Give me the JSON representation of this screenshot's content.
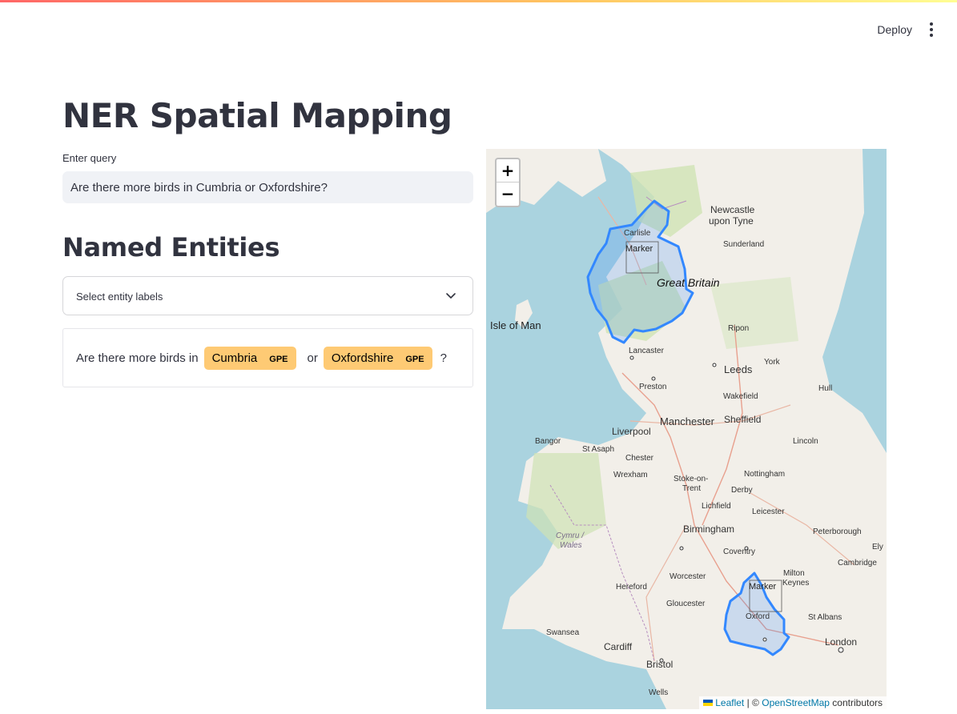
{
  "header": {
    "deploy_label": "Deploy",
    "menu_icon": "more-vertical-icon"
  },
  "page": {
    "title": "NER Spatial Mapping"
  },
  "query": {
    "label": "Enter query",
    "value": "Are there more birds in Cumbria or Oxfordshire?"
  },
  "entities": {
    "title": "Named Entities",
    "select_placeholder": "Select entity labels",
    "sentence": {
      "part1": "Are there more birds in",
      "entity1": {
        "text": "Cumbria",
        "label": "GPE"
      },
      "part2": "or",
      "entity2": {
        "text": "Oxfordshire",
        "label": "GPE"
      },
      "part3": "?"
    },
    "highlight_color": "#feca74"
  },
  "map": {
    "zoom_in_label": "+",
    "zoom_out_label": "−",
    "marker_label": "Marker",
    "places": {
      "newcastle_1": "Newcastle",
      "newcastle_2": "upon Tyne",
      "carlisle": "Carlisle",
      "sunderland": "Sunderland",
      "great_britain": "Great Britain",
      "isle_of_man": "Isle of Man",
      "ripon": "Ripon",
      "lancaster": "Lancaster",
      "leeds": "Leeds",
      "york": "York",
      "wakefield": "Wakefield",
      "hull": "Hull",
      "preston": "Preston",
      "manchester": "Manchester",
      "sheffield": "Sheffield",
      "liverpool": "Liverpool",
      "bangor": "Bangor",
      "st_asaph": "St Asaph",
      "chester": "Chester",
      "lincoln": "Lincoln",
      "wrexham": "Wrexham",
      "stoke_1": "Stoke-on-",
      "stoke_2": "Trent",
      "nottingham": "Nottingham",
      "derby": "Derby",
      "lichfield": "Lichfield",
      "leicester": "Leicester",
      "cymru_1": "Cymru /",
      "cymru_2": "Wales",
      "birmingham": "Birmingham",
      "peterborough": "Peterborough",
      "coventry": "Coventry",
      "ely": "Ely",
      "worcester": "Worcester",
      "cambridge": "Cambridge",
      "milton_1": "Milton",
      "milton_2": "Keynes",
      "hereford": "Hereford",
      "gloucester": "Gloucester",
      "oxford": "Oxford",
      "st_albans": "St Albans",
      "swansea": "Swansea",
      "cardiff": "Cardiff",
      "london": "London",
      "bristol": "Bristol",
      "wells": "Wells"
    },
    "attribution": {
      "leaflet": "Leaflet",
      "separator": "| ©",
      "osm": "OpenStreetMap",
      "suffix": "contributors"
    },
    "colors": {
      "sea": "#aad3df",
      "land": "#f2efe9",
      "polygon_stroke": "#3388ff"
    }
  }
}
